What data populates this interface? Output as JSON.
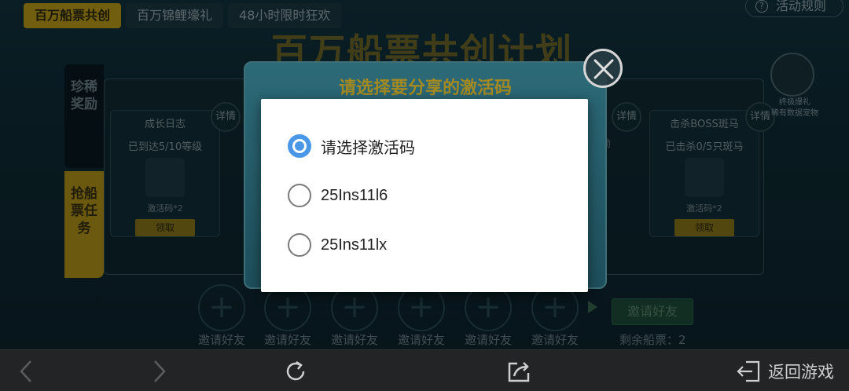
{
  "tabs": [
    {
      "label": "百万船票共创",
      "active": true
    },
    {
      "label": "百万锦鲤壕礼",
      "active": false
    },
    {
      "label": "48小时限时狂欢",
      "active": false
    }
  ],
  "rules_label": "活动规则",
  "big_title": "百万船票共创计划",
  "side_tabs": [
    "珍稀奖励",
    "抢船票任务"
  ],
  "cards": [
    {
      "title": "成长日志",
      "status": "已到达5/10等级",
      "reward": "激活码*2",
      "button": "领取"
    },
    {
      "title": "击杀BOSS斑马",
      "status": "已击杀0/5只斑马",
      "reward": "激活码*2",
      "button": "领取"
    }
  ],
  "detail_label": "详情",
  "peek_text": "励",
  "avatar_caption": "终极爆礼\n稀有数据宠物",
  "invite_slots": [
    "邀请好友",
    "邀请好友",
    "邀请好友",
    "邀请好友",
    "邀请好友",
    "邀请好友"
  ],
  "invite_button": "邀请好友",
  "remaining_tickets": "剩余船票：2",
  "modal": {
    "title": "请选择要分享的激活码",
    "options": [
      {
        "label": "请选择激活码",
        "selected": true
      },
      {
        "label": "25Ins11l6",
        "selected": false
      },
      {
        "label": "25Ins11lx",
        "selected": false
      }
    ]
  },
  "navbar": {
    "back_to_game": "返回游戏"
  },
  "colors": {
    "accent_gold": "#c5a21a",
    "radio_blue": "#4a97e8",
    "navbar_bg": "#222426"
  }
}
